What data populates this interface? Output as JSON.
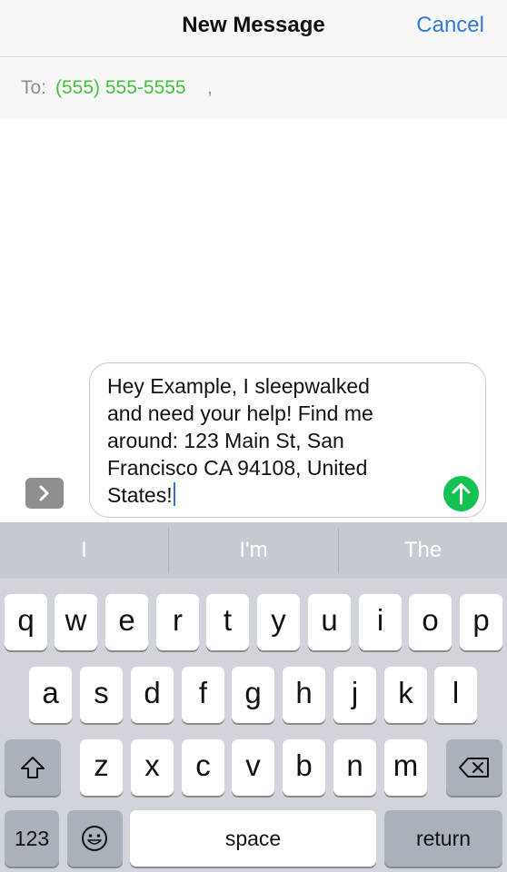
{
  "header": {
    "title": "New Message",
    "cancel_label": "Cancel"
  },
  "to_field": {
    "label": "To:",
    "recipient": "(555) 555-5555",
    "separator": ","
  },
  "message": {
    "lines": [
      "Hey Example, I sleepwalked",
      "and need your help! Find me",
      "around: 123 Main St, San",
      "Francisco CA 94108, United",
      "States!"
    ]
  },
  "suggestions": [
    "I",
    "I'm",
    "The"
  ],
  "keyboard": {
    "row1": [
      "q",
      "w",
      "e",
      "r",
      "t",
      "y",
      "u",
      "i",
      "o",
      "p"
    ],
    "row2": [
      "a",
      "s",
      "d",
      "f",
      "g",
      "h",
      "j",
      "k",
      "l"
    ],
    "row3": [
      "z",
      "x",
      "c",
      "v",
      "b",
      "n",
      "m"
    ],
    "numbers_label": "123",
    "space_label": "space",
    "return_label": "return"
  },
  "colors": {
    "accent": "#2f7bd6",
    "recipient": "#43c13f",
    "send": "#13c251"
  },
  "icons": {
    "expand": "chevron-right-icon",
    "send": "arrow-up-icon",
    "shift": "shift-icon",
    "delete": "backspace-icon",
    "emoji": "emoji-icon"
  }
}
